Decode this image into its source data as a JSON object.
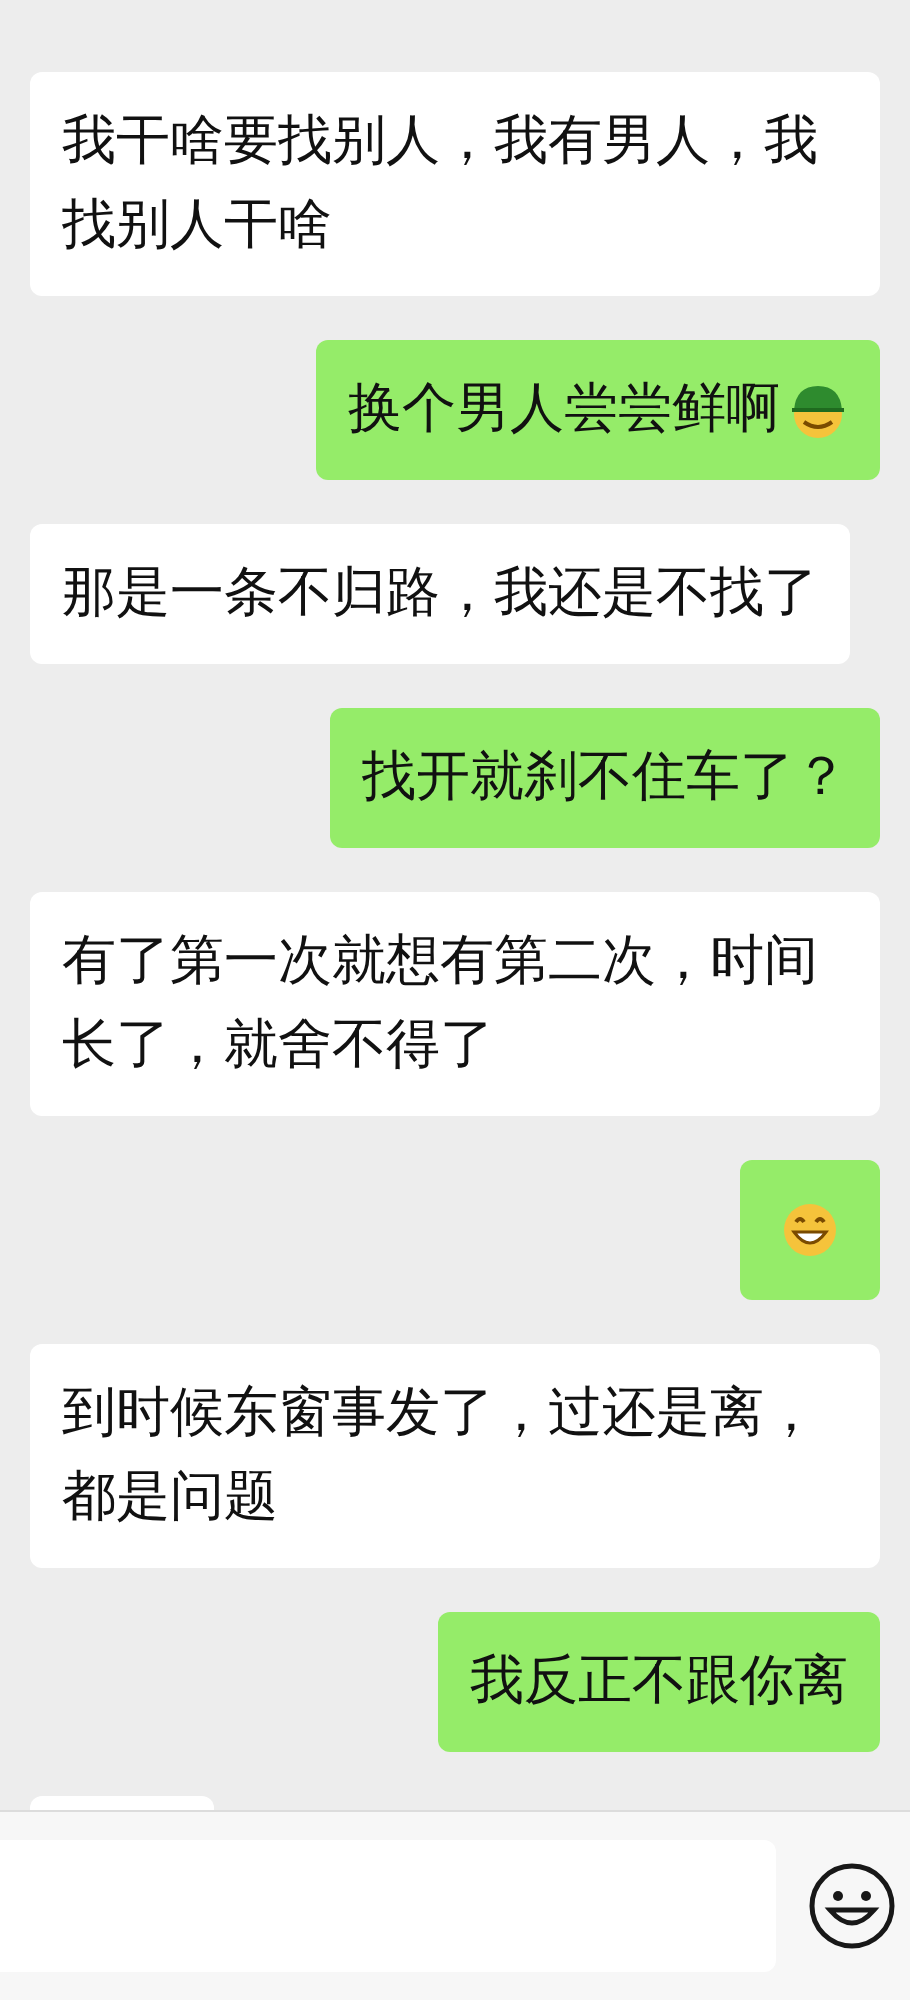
{
  "messages": [
    {
      "outgoing": false,
      "kind": "text",
      "text": "我干啥要找别人，我有男人，我找别人干啥"
    },
    {
      "outgoing": true,
      "kind": "text",
      "text": "换个男人尝尝鲜啊",
      "emoji": {
        "kind": "hat"
      }
    },
    {
      "outgoing": false,
      "kind": "text",
      "text": "那是一条不归路，我还是不找了"
    },
    {
      "outgoing": true,
      "kind": "text",
      "text": "找开就刹不住车了？"
    },
    {
      "outgoing": false,
      "kind": "text",
      "text": "有了第一次就想有第二次，时间长了，就舍不得了"
    },
    {
      "outgoing": true,
      "kind": "emoji",
      "emoji": {
        "kind": "grin"
      }
    },
    {
      "outgoing": false,
      "kind": "text",
      "text": "到时候东窗事发了，过还是离，都是问题"
    },
    {
      "outgoing": true,
      "kind": "text",
      "text": "我反正不跟你离"
    },
    {
      "outgoing": false,
      "kind": "cut"
    }
  ]
}
